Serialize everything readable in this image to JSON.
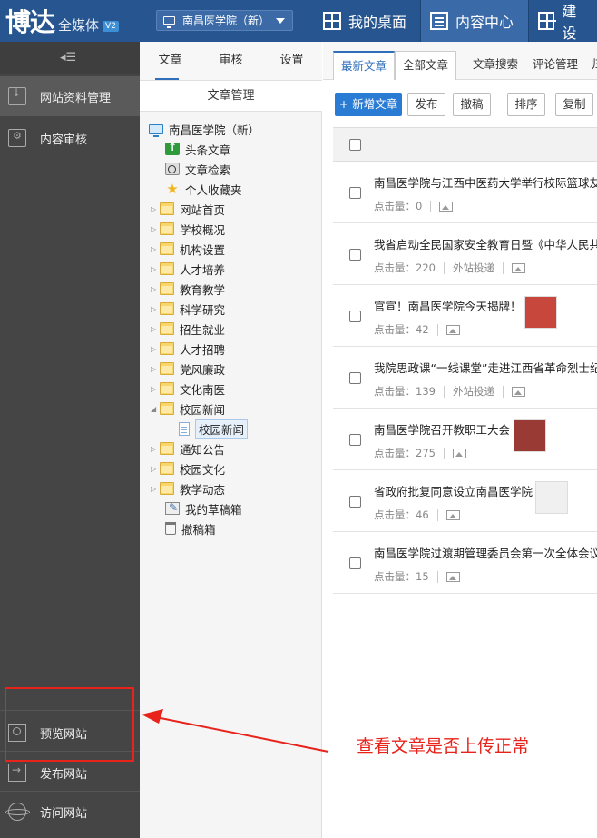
{
  "header": {
    "logo_main": "博达",
    "logo_sub": "全媒体",
    "logo_badge": "V2",
    "site_selector": "南昌医学院（新）",
    "nav": [
      {
        "label": "我的桌面",
        "icon": "grid-icon"
      },
      {
        "label": "内容中心",
        "icon": "document-icon"
      },
      {
        "label": "建设",
        "icon": "grid-icon"
      }
    ]
  },
  "sidebar": {
    "top_items": [
      {
        "label": "网站资料管理",
        "icon": "download-box-icon"
      },
      {
        "label": "内容审核",
        "icon": "gear-icon"
      }
    ],
    "bottom_items": [
      {
        "label": "预览网站",
        "icon": "preview-icon"
      },
      {
        "label": "发布网站",
        "icon": "publish-icon"
      },
      {
        "label": "访问网站",
        "icon": "globe-icon"
      }
    ]
  },
  "tree_panel": {
    "tabs": [
      "文章",
      "审核",
      "设置"
    ],
    "title": "文章管理",
    "root": "南昌医学院（新）",
    "specials": [
      "头条文章",
      "文章检索",
      "个人收藏夹"
    ],
    "folders": [
      "网站首页",
      "学校概况",
      "机构设置",
      "人才培养",
      "教育教学",
      "科学研究",
      "招生就业",
      "人才招聘",
      "党风廉政",
      "文化南医",
      "校园新闻"
    ],
    "open_child": "校园新闻",
    "folders_after": [
      "通知公告",
      "校园文化",
      "教学动态"
    ],
    "drafts": "我的草稿箱",
    "trash": "撤稿箱"
  },
  "main": {
    "tabs": [
      "最新文章",
      "全部文章",
      "文章搜索",
      "评论管理",
      "归"
    ],
    "toolbar": [
      "+ 新增文章",
      "发布",
      "撤稿",
      "排序",
      "复制"
    ],
    "articles": [
      {
        "title": "南昌医学院与江西中医药大学举行校际篮球友谊",
        "clicks_label": "点击量：",
        "clicks": "0",
        "source": "",
        "thumb": false
      },
      {
        "title": "我省启动全民国家安全教育日暨《中华人民共和",
        "clicks_label": "点击量：",
        "clicks": "220",
        "source": "外站投递",
        "thumb": false
      },
      {
        "title": "官宣！南昌医学院今天揭牌！",
        "clicks_label": "点击量：",
        "clicks": "42",
        "source": "",
        "thumb": true,
        "thumb_color": "#c8473c"
      },
      {
        "title": "我院思政课“一线课堂”走进江西省革命烈士纪",
        "clicks_label": "点击量：",
        "clicks": "139",
        "source": "外站投递",
        "thumb": false
      },
      {
        "title": "南昌医学院召开教职工大会",
        "clicks_label": "点击量：",
        "clicks": "275",
        "source": "",
        "thumb": true,
        "thumb_color": "#9a3a35"
      },
      {
        "title": "省政府批复同意设立南昌医学院",
        "clicks_label": "点击量：",
        "clicks": "46",
        "source": "",
        "thumb": true,
        "thumb_color": "#f0f0f0"
      },
      {
        "title": "南昌医学院过渡期管理委员会第一次全体会议召",
        "clicks_label": "点击量：",
        "clicks": "15",
        "source": "",
        "thumb": false
      }
    ]
  },
  "annotation": {
    "text": "查看文章是否上传正常",
    "color": "#e8231b"
  },
  "colors": {
    "header_bg": "#26558f",
    "sidebar_bg": "#454545",
    "accent": "#2a7bd4"
  }
}
